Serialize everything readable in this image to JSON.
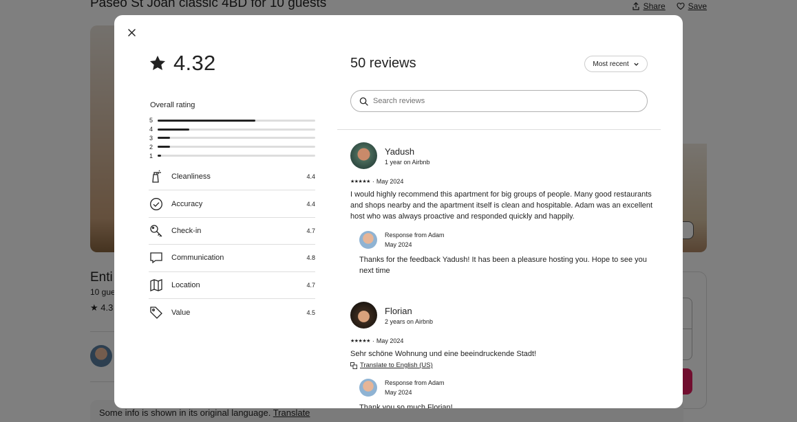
{
  "background": {
    "listing_title": "Paseo St Joan classic 4BD for 10 guests",
    "share_label": "Share",
    "save_label": "Save",
    "entire_text": "Enti",
    "guests_text": "10 gue",
    "rating_text": "4.3",
    "info_text": "Some info is shown in its original language.",
    "translate_label": "Translate"
  },
  "modal": {
    "overall_score": "4.32",
    "overall_rating_label": "Overall rating",
    "distribution": [
      {
        "stars": "5",
        "fraction": 0.62
      },
      {
        "stars": "4",
        "fraction": 0.2
      },
      {
        "stars": "3",
        "fraction": 0.08
      },
      {
        "stars": "2",
        "fraction": 0.08
      },
      {
        "stars": "1",
        "fraction": 0.02
      }
    ],
    "categories": [
      {
        "label": "Cleanliness",
        "value": "4.4",
        "icon": "spray-bottle-icon"
      },
      {
        "label": "Accuracy",
        "value": "4.4",
        "icon": "check-circle-icon"
      },
      {
        "label": "Check-in",
        "value": "4.7",
        "icon": "key-icon"
      },
      {
        "label": "Communication",
        "value": "4.8",
        "icon": "chat-bubble-icon"
      },
      {
        "label": "Location",
        "value": "4.7",
        "icon": "map-icon"
      },
      {
        "label": "Value",
        "value": "4.5",
        "icon": "tag-icon"
      }
    ],
    "reviews_count_title": "50 reviews",
    "sort_label": "Most recent",
    "search_placeholder": "Search reviews",
    "reviews": [
      {
        "name": "Yadush",
        "tenure": "1 year on Airbnb",
        "stars": "★★★★★",
        "separator": "·",
        "date": "May 2024",
        "text": "I would highly recommend this apartment for big groups of people. Many good restaurants and shops nearby and the apartment itself is clean and hospitable. Adam was an excellent host who was always proactive and responded quickly and happily.",
        "response_from": "Response from Adam",
        "response_date": "May 2024",
        "response_text": "Thanks for the feedback Yadush! It has been a pleasure hosting you. Hope to see you next time"
      },
      {
        "name": "Florian",
        "tenure": "2 years on Airbnb",
        "stars": "★★★★★",
        "separator": "·",
        "date": "May 2024",
        "text": "Sehr schöne Wohnung und eine beeindruckende Stadt!",
        "translate_label": "Translate to English (US)",
        "response_from": "Response from Adam",
        "response_date": "May 2024",
        "response_text": "Thank you so much Florian!"
      }
    ]
  }
}
